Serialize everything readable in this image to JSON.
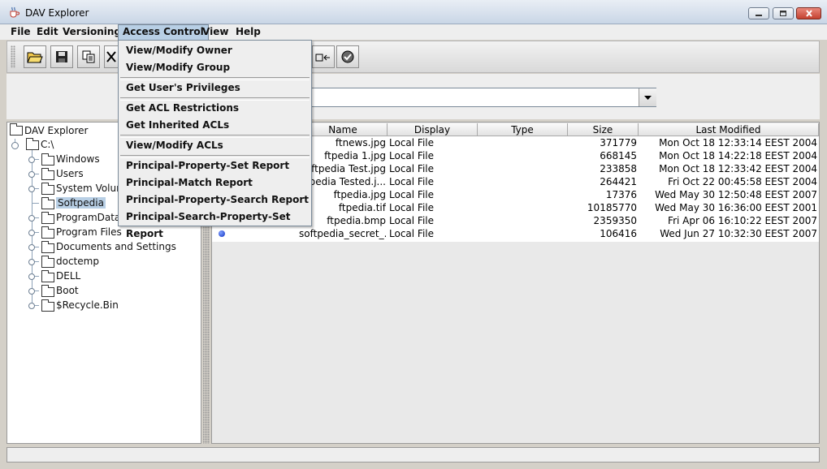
{
  "window": {
    "title": "DAV Explorer",
    "icon": "java-cup-icon"
  },
  "menubar": [
    "File",
    "Edit",
    "Versioning",
    "Access Control",
    "View",
    "Help"
  ],
  "active_menu": "Access Control",
  "dropdown": [
    [
      "View/Modify Owner",
      "View/Modify Group"
    ],
    [
      "Get User's Privileges"
    ],
    [
      "Get ACL Restrictions",
      "Get Inherited ACLs"
    ],
    [
      "View/Modify ACLs"
    ],
    [
      "Principal-Property-Set Report",
      "Principal-Match Report",
      "Principal-Property-Search Report",
      "Principal-Search-Property-Set Report"
    ]
  ],
  "toolbar": {
    "icons": [
      "open-folder-icon",
      "save-icon",
      "copy-icon",
      "cut-icon",
      "lock-icon",
      "unlock-icon"
    ]
  },
  "url": {
    "value": ""
  },
  "tree": {
    "root": "DAV Explorer",
    "drive": "C:\\",
    "children": [
      "Windows",
      "Users",
      "System Volum",
      "Softpedia",
      "ProgramData",
      "Program Files",
      "Documents and Settings",
      "doctemp",
      "DELL",
      "Boot",
      "$Recycle.Bin"
    ],
    "selected": "Softpedia"
  },
  "table": {
    "columns": [
      "Name",
      "Display",
      "Type",
      "Size",
      "Last Modified"
    ],
    "rows": [
      {
        "name": "ftnews.jpg",
        "display": "Local File",
        "type": "",
        "size": "371779",
        "modified": "Mon Oct 18 12:33:14 EEST 2004"
      },
      {
        "name": "ftpedia 1.jpg",
        "display": "Local File",
        "type": "",
        "size": "668145",
        "modified": "Mon Oct 18 14:22:18 EEST 2004"
      },
      {
        "name": "ftpedia Test.jpg",
        "display": "Local File",
        "type": "",
        "size": "233858",
        "modified": "Mon Oct 18 12:33:42 EEST 2004"
      },
      {
        "name": "ftpedia Tested.j...",
        "display": "Local File",
        "type": "",
        "size": "264421",
        "modified": "Fri Oct 22 00:45:58 EEST 2004"
      },
      {
        "name": "ftpedia.jpg",
        "display": "Local File",
        "type": "",
        "size": "17376",
        "modified": "Wed May 30 12:50:48 EEST 2007"
      },
      {
        "name": "ftpedia.tif",
        "display": "Local File",
        "type": "",
        "size": "10185770",
        "modified": "Wed May 30 16:36:00 EEST 2001"
      },
      {
        "name": "ftpedia.bmp",
        "display": "Local File",
        "type": "",
        "size": "2359350",
        "modified": "Fri Apr 06 16:10:22 EEST 2007"
      },
      {
        "name": "softpedia_secret_...",
        "display": "Local File",
        "type": "",
        "size": "106416",
        "modified": "Wed Jun 27 10:32:30 EEST 2007"
      }
    ]
  },
  "colors": {
    "selection": "#b8cfe5",
    "menubar": "#eeeeee",
    "bullet": "#1030c0"
  }
}
